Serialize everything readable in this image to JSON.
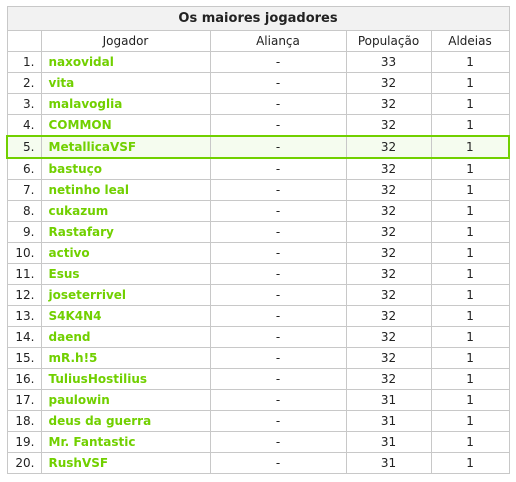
{
  "table": {
    "title": "Os maiores jogadores",
    "headers": {
      "rank": "",
      "player": "Jogador",
      "alliance": "Aliança",
      "population": "População",
      "villages": "Aldeias"
    },
    "highlight_rank": "5.",
    "rows": [
      {
        "rank": "1.",
        "player": "naxovidal",
        "alliance": "-",
        "population": "33",
        "villages": "1"
      },
      {
        "rank": "2.",
        "player": "vita",
        "alliance": "-",
        "population": "32",
        "villages": "1"
      },
      {
        "rank": "3.",
        "player": "malavoglia",
        "alliance": "-",
        "population": "32",
        "villages": "1"
      },
      {
        "rank": "4.",
        "player": "COMMON",
        "alliance": "-",
        "population": "32",
        "villages": "1"
      },
      {
        "rank": "5.",
        "player": "MetallicaVSF",
        "alliance": "-",
        "population": "32",
        "villages": "1"
      },
      {
        "rank": "6.",
        "player": "bastuço",
        "alliance": "-",
        "population": "32",
        "villages": "1"
      },
      {
        "rank": "7.",
        "player": "netinho leal",
        "alliance": "-",
        "population": "32",
        "villages": "1"
      },
      {
        "rank": "8.",
        "player": "cukazum",
        "alliance": "-",
        "population": "32",
        "villages": "1"
      },
      {
        "rank": "9.",
        "player": "Rastafary",
        "alliance": "-",
        "population": "32",
        "villages": "1"
      },
      {
        "rank": "10.",
        "player": "activo",
        "alliance": "-",
        "population": "32",
        "villages": "1"
      },
      {
        "rank": "11.",
        "player": "Esus",
        "alliance": "-",
        "population": "32",
        "villages": "1"
      },
      {
        "rank": "12.",
        "player": "joseterrivel",
        "alliance": "-",
        "population": "32",
        "villages": "1"
      },
      {
        "rank": "13.",
        "player": "S4K4N4",
        "alliance": "-",
        "population": "32",
        "villages": "1"
      },
      {
        "rank": "14.",
        "player": "daend",
        "alliance": "-",
        "population": "32",
        "villages": "1"
      },
      {
        "rank": "15.",
        "player": "mR.h!5",
        "alliance": "-",
        "population": "32",
        "villages": "1"
      },
      {
        "rank": "16.",
        "player": "TuliusHostilius",
        "alliance": "-",
        "population": "32",
        "villages": "1"
      },
      {
        "rank": "17.",
        "player": "paulowin",
        "alliance": "-",
        "population": "31",
        "villages": "1"
      },
      {
        "rank": "18.",
        "player": "deus da guerra",
        "alliance": "-",
        "population": "31",
        "villages": "1"
      },
      {
        "rank": "19.",
        "player": "Mr. Fantastic",
        "alliance": "-",
        "population": "31",
        "villages": "1"
      },
      {
        "rank": "20.",
        "player": "RushVSF",
        "alliance": "-",
        "population": "31",
        "villages": "1"
      }
    ]
  },
  "colors": {
    "player_link": "#71d000",
    "highlight_border": "#71d000",
    "header_bg": "#f2f2f2"
  }
}
